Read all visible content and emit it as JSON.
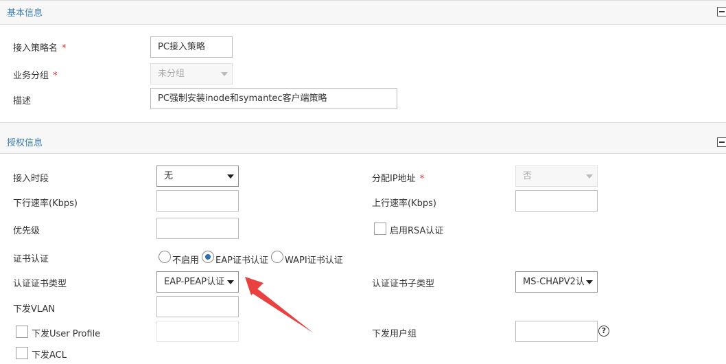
{
  "sections": {
    "basic": {
      "title": "基本信息"
    },
    "auth": {
      "title": "授权信息"
    }
  },
  "basic": {
    "policy_name": {
      "label": "接入策略名",
      "required": "*",
      "value": "PC接入策略"
    },
    "service_group": {
      "label": "业务分组",
      "required": "*",
      "value": "未分组"
    },
    "description": {
      "label": "描述",
      "value": "PC强制安装inode和symantec客户端策略"
    }
  },
  "auth": {
    "access_period": {
      "label": "接入时段",
      "value": "无"
    },
    "assign_ip": {
      "label": "分配IP地址",
      "required": "*",
      "value": "否"
    },
    "downlink_rate": {
      "label": "下行速率(Kbps)",
      "value": ""
    },
    "uplink_rate": {
      "label": "上行速率(Kbps)",
      "value": ""
    },
    "priority": {
      "label": "优先级",
      "value": ""
    },
    "enable_rsa": {
      "label": "启用RSA认证",
      "checked": false
    },
    "cert_auth": {
      "label": "证书认证",
      "options": [
        "不启用",
        "EAP证书认证",
        "WAPI证书认证"
      ],
      "selected": "EAP证书认证"
    },
    "cert_type": {
      "label": "认证证书类型",
      "value": "EAP-PEAP认证"
    },
    "cert_subtype": {
      "label": "认证证书子类型",
      "value": "MS-CHAPV2认"
    },
    "deliver_vlan": {
      "label": "下发VLAN",
      "value": ""
    },
    "deliver_user_profile": {
      "label": "下发User Profile",
      "checked": false,
      "value": ""
    },
    "deliver_user_group": {
      "label": "下发用户组",
      "value": "",
      "help": "?"
    },
    "deliver_acl": {
      "label": "下发ACL",
      "checked": false
    }
  },
  "colors": {
    "accent": "#2a7ac0",
    "section_title": "#3b7fb7",
    "required": "#e03030",
    "arrow": "#e8413f"
  }
}
